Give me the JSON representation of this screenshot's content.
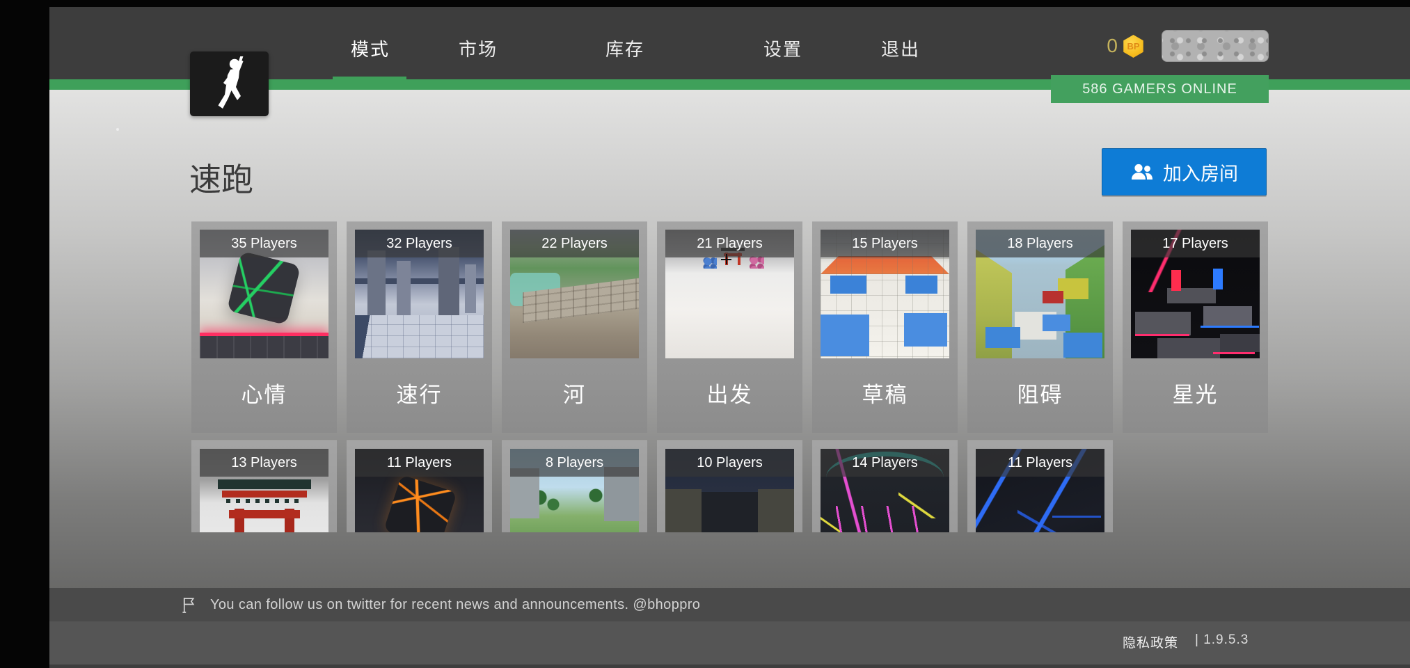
{
  "theme": {
    "accent_green": "#3fa05a",
    "button_blue": "#0e7cd6",
    "coin_gold": "#f6bc1d",
    "header_gray": "#3d3d3d"
  },
  "header": {
    "nav": [
      {
        "label": "模式",
        "active": true
      },
      {
        "label": "市场",
        "active": false
      },
      {
        "label": "库存",
        "active": false
      },
      {
        "label": "设置",
        "active": false
      },
      {
        "label": "退出",
        "active": false
      }
    ],
    "balance": {
      "value": "0",
      "coin_label": "BP"
    },
    "online_badge": "586 GAMERS ONLINE"
  },
  "main": {
    "title": "速跑",
    "join_label": "加入房间"
  },
  "maps": [
    {
      "players": "35 Players",
      "name": "心情",
      "thumb": "mood"
    },
    {
      "players": "32 Players",
      "name": "速行",
      "thumb": "fast"
    },
    {
      "players": "22 Players",
      "name": "河",
      "thumb": "river"
    },
    {
      "players": "21 Players",
      "name": "出发",
      "thumb": "depart"
    },
    {
      "players": "15 Players",
      "name": "草稿",
      "thumb": "draft"
    },
    {
      "players": "18 Players",
      "name": "阻碍",
      "thumb": "obstacle"
    },
    {
      "players": "17 Players",
      "name": "星光",
      "thumb": "star"
    },
    {
      "players": "13 Players",
      "name": "",
      "thumb": "torii"
    },
    {
      "players": "11 Players",
      "name": "",
      "thumb": "ocube"
    },
    {
      "players": "8 Players",
      "name": "",
      "thumb": "field"
    },
    {
      "players": "10 Players",
      "name": "",
      "thumb": "night"
    },
    {
      "players": "14 Players",
      "name": "",
      "thumb": "npink"
    },
    {
      "players": "11 Players",
      "name": "",
      "thumb": "nblue"
    }
  ],
  "footer": {
    "news": "You can follow us on twitter for recent news and announcements. @bhoppro",
    "privacy_label": "隐私政策",
    "version_label": "| 1.9.5.3"
  }
}
